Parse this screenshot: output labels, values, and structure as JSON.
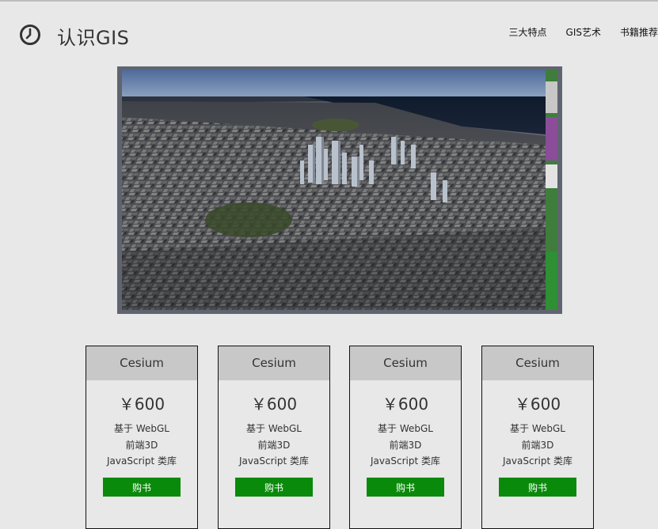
{
  "header": {
    "logo_icon": "clock-icon",
    "title": "认识GIS",
    "nav": [
      "三大特点",
      "GIS艺术",
      "书籍推荐"
    ]
  },
  "hero": {
    "image_icon": "city-3d-photo"
  },
  "cards": [
    {
      "name": "Cesium",
      "price": "￥600",
      "features": [
        "基于 WebGL",
        "前端3D",
        "JavaScript 类库"
      ],
      "button": "购书"
    },
    {
      "name": "Cesium",
      "price": "￥600",
      "features": [
        "基于 WebGL",
        "前端3D",
        "JavaScript 类库"
      ],
      "button": "购书"
    },
    {
      "name": "Cesium",
      "price": "￥600",
      "features": [
        "基于 WebGL",
        "前端3D",
        "JavaScript 类库"
      ],
      "button": "购书"
    },
    {
      "name": "Cesium",
      "price": "￥600",
      "features": [
        "基于 WebGL",
        "前端3D",
        "JavaScript 类库"
      ],
      "button": "购书"
    }
  ],
  "colors": {
    "background": "#e8e8e8",
    "card_header": "#c8c8c8",
    "button": "#0a8a0a",
    "hero_frame": "#5f6470"
  }
}
